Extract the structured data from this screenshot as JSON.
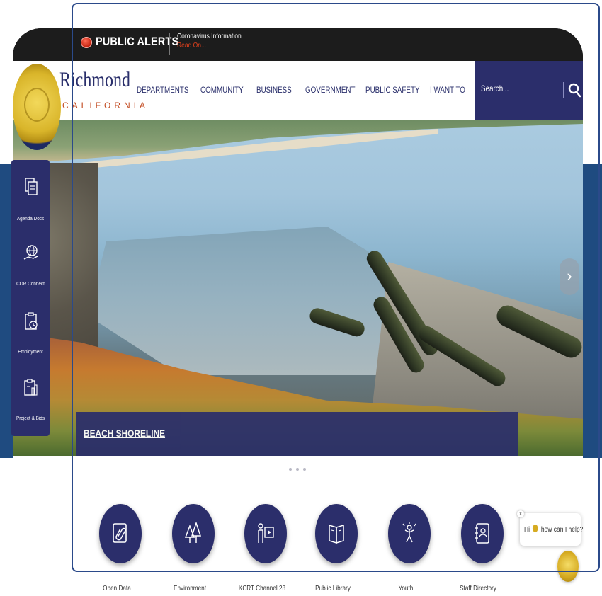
{
  "alert": {
    "title": "PUBLIC ALERTS",
    "info": "Coronavirus Information",
    "link": "Read On..."
  },
  "header": {
    "logo_name": "Richmond",
    "logo_sub": "CALIFORNIA",
    "nav": [
      "DEPARTMENTS",
      "COMMUNITY",
      "BUSINESS",
      "GOVERNMENT",
      "PUBLIC SAFETY",
      "I WANT TO"
    ],
    "search_placeholder": "Search..."
  },
  "hero": {
    "caption": "BEACH SHORELINE",
    "next_icon": "chevron-right-icon",
    "slide_count": 3
  },
  "quick_links": [
    {
      "label": "Agenda Docs",
      "icon": "document-icon"
    },
    {
      "label": "COR Connect",
      "icon": "globe-hand-icon"
    },
    {
      "label": "Employment",
      "icon": "clipboard-clock-icon"
    },
    {
      "label": "Project & Bids",
      "icon": "clipboard-chart-icon"
    }
  ],
  "bottom_links": [
    {
      "label": "Open Data",
      "icon": "paperclip-document-icon"
    },
    {
      "label": "Environment",
      "icon": "trees-icon"
    },
    {
      "label": "KCRT Channel 28",
      "icon": "presenter-icon"
    },
    {
      "label": "Public Library",
      "icon": "book-icon"
    },
    {
      "label": "Youth",
      "icon": "youth-icon"
    },
    {
      "label": "Staff Directory",
      "icon": "address-book-icon"
    }
  ],
  "chat": {
    "greeting": "Hi",
    "message": "how can I help?",
    "close": "x"
  },
  "colors": {
    "brand_navy": "#2b2e6b",
    "alert_red": "#c3220f",
    "accent_orange": "#c24a20",
    "side_band_blue": "#1f4b80"
  }
}
